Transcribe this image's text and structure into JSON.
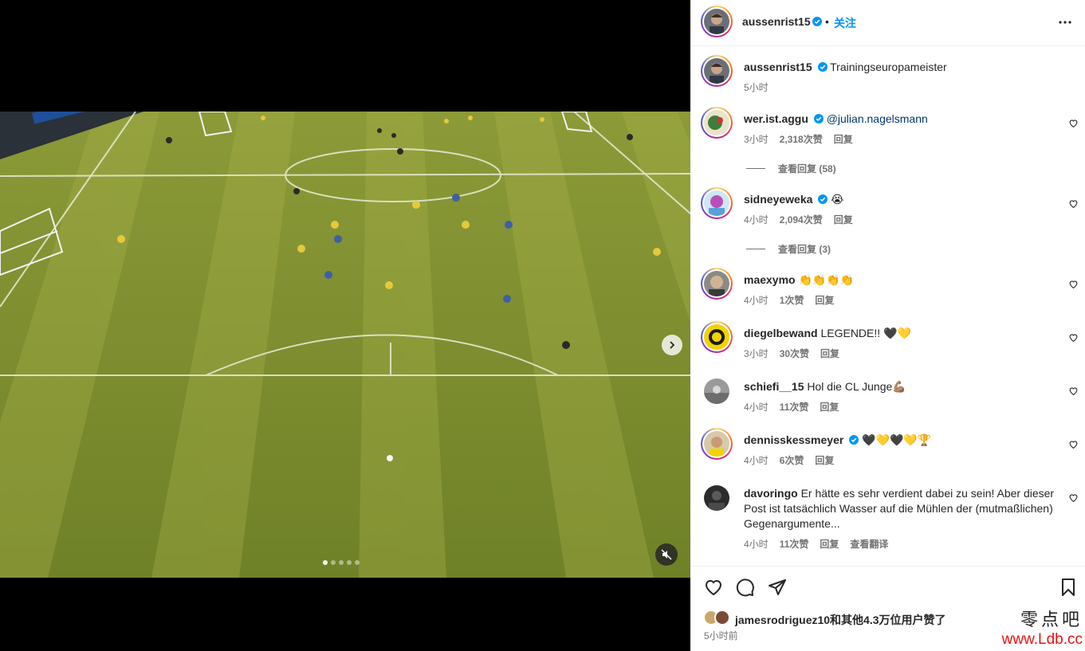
{
  "post": {
    "author": "aussenrist15",
    "follow_label": "关注",
    "separator": "•",
    "caption": "Trainingseuropameister",
    "caption_time": "5小时",
    "likes_text": "jamesrodriguez10和其他4.3万位用户赞了",
    "time_ago": "5小时前"
  },
  "comments": [
    {
      "user": "wer.ist.aggu",
      "verified": true,
      "text": "@julian.nagelsmann",
      "time": "3小时",
      "likes": "2,318次赞",
      "reply": "回复",
      "view_replies": "查看回复 (58)"
    },
    {
      "user": "sidneyeweka",
      "verified": true,
      "text": "😭",
      "time": "4小时",
      "likes": "2,094次赞",
      "reply": "回复",
      "view_replies": "查看回复 (3)"
    },
    {
      "user": "maexymo",
      "verified": false,
      "text": "👏👏👏👏",
      "time": "4小时",
      "likes": "1次赞",
      "reply": "回复"
    },
    {
      "user": "diegelbewand",
      "verified": false,
      "text": "LEGENDE!! 🖤💛",
      "time": "3小时",
      "likes": "30次赞",
      "reply": "回复"
    },
    {
      "user": "schiefi__15",
      "verified": false,
      "text": "Hol die CL Junge💪🏽",
      "time": "4小时",
      "likes": "11次赞",
      "reply": "回复"
    },
    {
      "user": "dennisskessmeyer",
      "verified": true,
      "text": "🖤💛🖤💛🏆",
      "time": "4小时",
      "likes": "6次赞",
      "reply": "回复"
    },
    {
      "user": "davoringo",
      "verified": false,
      "text_line1": "Er hätte es sehr verdient dabei zu sein! Aber dieser",
      "text_line2": "Post ist tatsächlich Wasser auf die Mühlen der (mutmaßlichen)",
      "text_line3": "Gegenargumente...",
      "time": "4小时",
      "likes": "11次赞",
      "reply": "回复",
      "translate": "查看翻译"
    }
  ],
  "media": {
    "slide_count": 5,
    "active_slide": 1
  },
  "icons": {
    "verified": "verified-badge-icon",
    "more": "more-options-icon",
    "like": "heart-icon",
    "comment": "comment-icon",
    "share": "share-icon",
    "save": "bookmark-icon",
    "next": "chevron-right-icon",
    "mute": "muted-speaker-icon"
  },
  "colors": {
    "accent": "#0095f6",
    "verified": "#0095f6",
    "text": "#262626",
    "muted": "#737373"
  },
  "watermark": {
    "cn": "零点吧",
    "url": "www.Ldb.cc"
  }
}
